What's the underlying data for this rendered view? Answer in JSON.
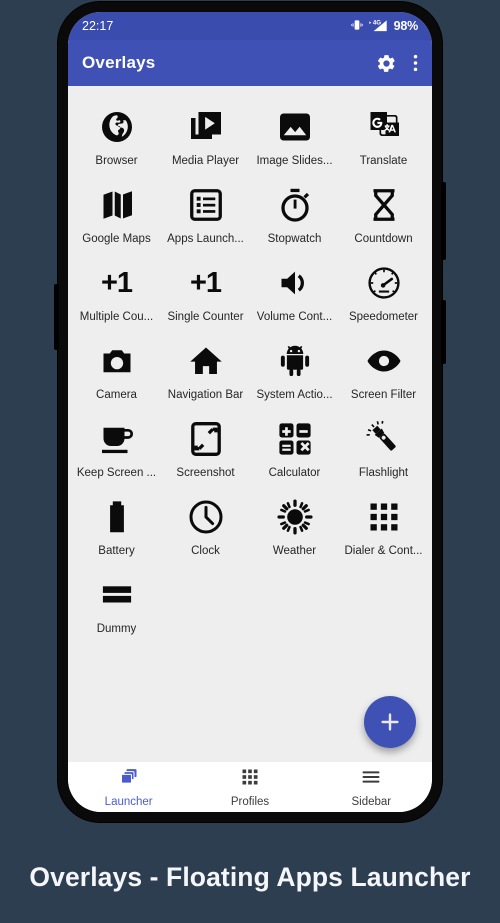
{
  "status_bar": {
    "time": "22:17",
    "battery": "98%",
    "icons": [
      "vibrate-icon",
      "signal-4g-icon"
    ],
    "network_label": "4G"
  },
  "app_bar": {
    "title": "Overlays",
    "actions": [
      {
        "name": "settings-button",
        "icon": "gear-icon"
      },
      {
        "name": "overflow-menu-button",
        "icon": "three-dots-vertical-icon"
      }
    ]
  },
  "colors": {
    "accent": "#3f51b5",
    "status_bar": "#3b4caf",
    "page_background": "#2e3e51",
    "screen_background": "#eeeeee",
    "nav_active": "#4a5ccd"
  },
  "launcher": {
    "items": [
      {
        "label": "Browser",
        "icon": "globe-icon"
      },
      {
        "label": "Media Player",
        "icon": "media-player-icon"
      },
      {
        "label": "Image Slides...",
        "icon": "image-icon"
      },
      {
        "label": "Translate",
        "icon": "translate-icon"
      },
      {
        "label": "Google Maps",
        "icon": "map-icon"
      },
      {
        "label": "Apps Launch...",
        "icon": "list-icon"
      },
      {
        "label": "Stopwatch",
        "icon": "stopwatch-icon"
      },
      {
        "label": "Countdown",
        "icon": "hourglass-icon"
      },
      {
        "label": "Multiple Cou...",
        "icon": "plus-one-icon"
      },
      {
        "label": "Single Counter",
        "icon": "plus-one-icon"
      },
      {
        "label": "Volume Cont...",
        "icon": "volume-icon"
      },
      {
        "label": "Speedometer",
        "icon": "speedometer-icon"
      },
      {
        "label": "Camera",
        "icon": "camera-icon"
      },
      {
        "label": "Navigation Bar",
        "icon": "home-icon"
      },
      {
        "label": "System Actio...",
        "icon": "android-robot-icon"
      },
      {
        "label": "Screen Filter",
        "icon": "eye-icon"
      },
      {
        "label": "Keep Screen ...",
        "icon": "coffee-cup-icon"
      },
      {
        "label": "Screenshot",
        "icon": "screenshot-icon"
      },
      {
        "label": "Calculator",
        "icon": "calculator-icon"
      },
      {
        "label": "Flashlight",
        "icon": "flashlight-icon"
      },
      {
        "label": "Battery",
        "icon": "battery-icon"
      },
      {
        "label": "Clock",
        "icon": "clock-icon"
      },
      {
        "label": "Weather",
        "icon": "sun-icon"
      },
      {
        "label": "Dialer & Cont...",
        "icon": "dialpad-icon"
      },
      {
        "label": "Dummy",
        "icon": "two-bars-icon"
      }
    ]
  },
  "fab": {
    "label": "+",
    "name": "add-overlay-button"
  },
  "bottom_nav": {
    "items": [
      {
        "label": "Launcher",
        "icon": "layers-icon",
        "active": true
      },
      {
        "label": "Profiles",
        "icon": "grid-dots-icon",
        "active": false
      },
      {
        "label": "Sidebar",
        "icon": "hamburger-icon",
        "active": false
      }
    ]
  },
  "caption": {
    "text": "Overlays - Floating Apps Launcher"
  }
}
